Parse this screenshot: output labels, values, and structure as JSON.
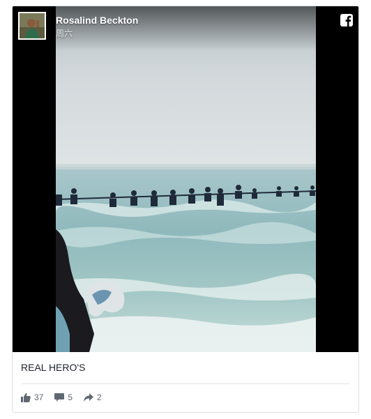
{
  "post": {
    "author": "Rosalind Beckton",
    "time": "周六",
    "caption": "REAL HERO'S"
  },
  "stats": {
    "likes": "37",
    "comments": "5",
    "shares": "2"
  },
  "icons": {
    "platform": "facebook-icon",
    "like": "thumbs-up-icon",
    "comment": "speech-bubble-icon",
    "share": "share-arrow-icon"
  },
  "colors": {
    "card_border": "#dddfe2",
    "text": "#1d2129",
    "muted": "#616770"
  }
}
